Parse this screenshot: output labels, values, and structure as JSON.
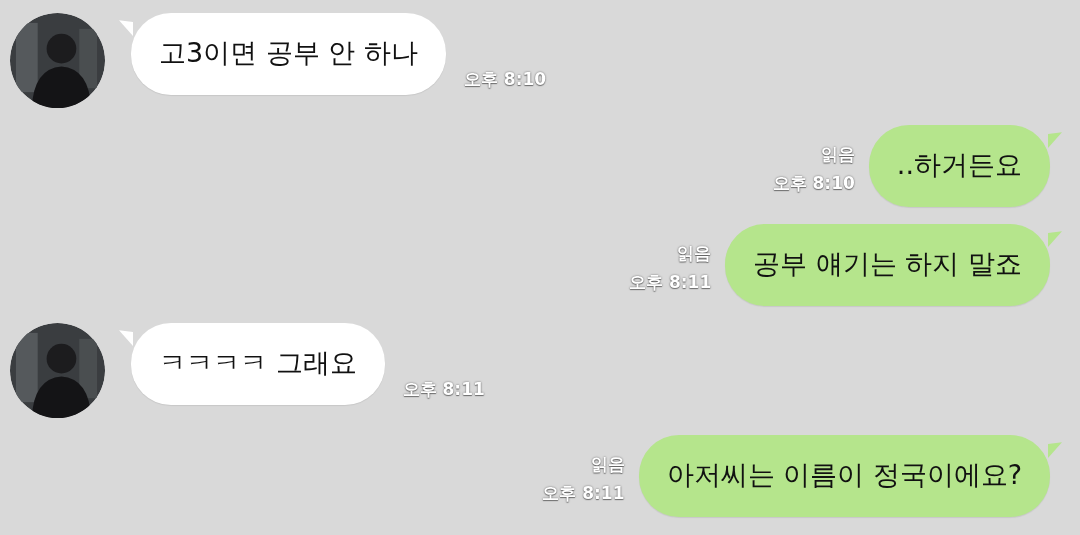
{
  "messages": [
    {
      "kind": "incoming",
      "text": "고3이면 공부 안 하나",
      "time": "오후 8:10"
    },
    {
      "kind": "outgoing",
      "text": "..하거든요",
      "read": "읽음",
      "time": "오후 8:10"
    },
    {
      "kind": "outgoing",
      "text": "공부 얘기는 하지 말죠",
      "read": "읽음",
      "time": "오후 8:11"
    },
    {
      "kind": "incoming",
      "text": "ㅋㅋㅋㅋ 그래요",
      "time": "오후 8:11"
    },
    {
      "kind": "outgoing",
      "text": "아저씨는 이름이 정국이에요?",
      "read": "읽음",
      "time": "오후 8:11"
    }
  ]
}
